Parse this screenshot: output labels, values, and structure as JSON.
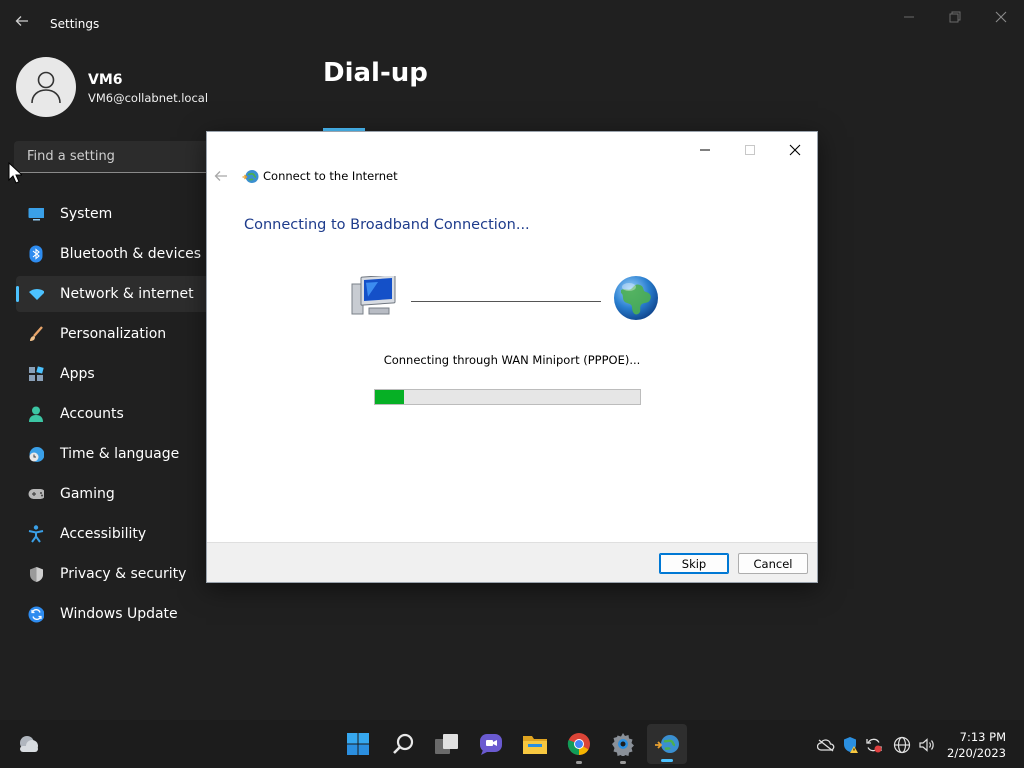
{
  "window": {
    "app_title": "Settings"
  },
  "user": {
    "name": "VM6",
    "email": "VM6@collabnet.local"
  },
  "search": {
    "placeholder": "Find a setting"
  },
  "sidebar": {
    "items": [
      {
        "label": "System",
        "icon": "system-icon"
      },
      {
        "label": "Bluetooth & devices",
        "icon": "bluetooth-icon"
      },
      {
        "label": "Network & internet",
        "icon": "wifi-icon",
        "active": true
      },
      {
        "label": "Personalization",
        "icon": "brush-icon"
      },
      {
        "label": "Apps",
        "icon": "apps-icon"
      },
      {
        "label": "Accounts",
        "icon": "person-icon"
      },
      {
        "label": "Time & language",
        "icon": "clock-globe-icon"
      },
      {
        "label": "Gaming",
        "icon": "gamepad-icon"
      },
      {
        "label": "Accessibility",
        "icon": "accessibility-icon"
      },
      {
        "label": "Privacy & security",
        "icon": "shield-icon"
      },
      {
        "label": "Windows Update",
        "icon": "update-icon"
      }
    ]
  },
  "main": {
    "page_title": "Dial-up"
  },
  "dialog": {
    "title": "Connect to the Internet",
    "heading": "Connecting to Broadband Connection...",
    "status": "Connecting through WAN Miniport (PPPOE)...",
    "progress": 0.11,
    "buttons": {
      "skip": "Skip",
      "cancel": "Cancel"
    }
  },
  "taskbar": {
    "items": [
      "weather",
      "start",
      "search",
      "task-view",
      "teams-chat",
      "file-explorer",
      "chrome",
      "settings",
      "connect-internet"
    ],
    "clock": {
      "time": "7:13 PM",
      "date": "2/20/2023"
    }
  },
  "colors": {
    "accent": "#4cc2ff",
    "progress": "#06b025",
    "dialog_heading": "#1e3c8c"
  }
}
